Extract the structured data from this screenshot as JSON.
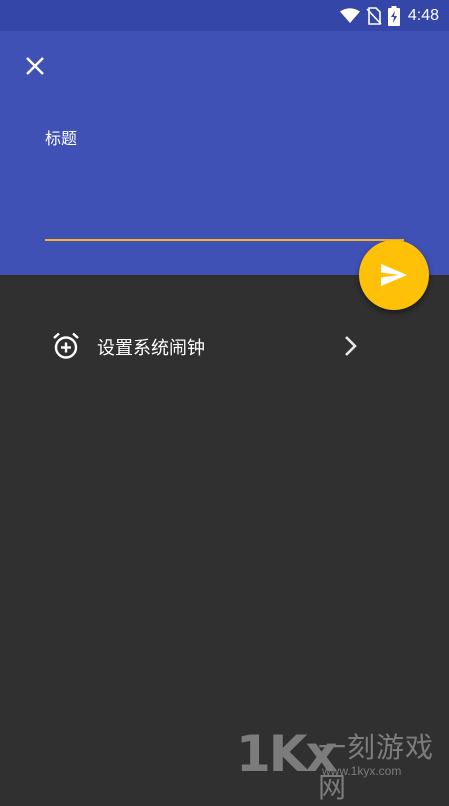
{
  "status_bar": {
    "time": "4:48",
    "icons": [
      "wifi-icon",
      "no-sim-icon",
      "battery-charging-icon"
    ]
  },
  "header": {
    "close_icon": "close-icon",
    "title_label": "标题",
    "title_value": "",
    "bg_color": "#3f51b5",
    "underline_color": "#f5b52a"
  },
  "fab": {
    "icon": "send-icon",
    "color": "#ffc107"
  },
  "alarm": {
    "icon": "add-alarm-icon",
    "label": "设置系统闹钟",
    "chevron_icon": "chevron-right-icon"
  },
  "watermark": {
    "logo": "1Kx",
    "site_name": "一刻游戏网",
    "url": "www.1kyx.com"
  }
}
